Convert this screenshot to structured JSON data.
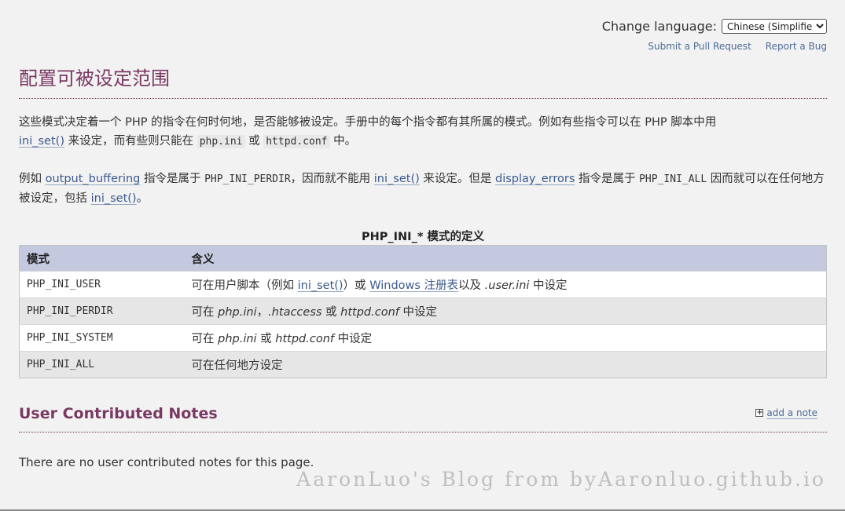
{
  "header": {
    "change_language_label": "Change language:",
    "language_selected": "Chinese (Simplified)",
    "submit_pr": "Submit a Pull Request",
    "report_bug": "Report a Bug"
  },
  "title": "配置可被设定范围",
  "p1": {
    "t1": "这些模式决定着一个 PHP 的指令在何时何地，是否能够被设定。手册中的每个指令都有其所属的模式。例如有些指令可以在 PHP 脚本中用",
    "link_ini_set": "ini_set()",
    "t2": " 来设定，而有些则只能在 ",
    "code_phpini": "php.ini",
    "t3": " 或 ",
    "code_httpd": "httpd.conf",
    "t4": " 中。"
  },
  "p2": {
    "t1": "例如 ",
    "link_output_buffering": "output_buffering",
    "t2": " 指令是属于 ",
    "const_perdir": "PHP_INI_PERDIR",
    "t3": "，因而就不能用 ",
    "link_ini_set": "ini_set()",
    "t4": " 来设定。但是 ",
    "link_display_errors": "display_errors",
    "t5": " 指令是属于 ",
    "const_all": "PHP_INI_ALL",
    "t6": " 因而就可以在任何地方被设定，包括 ",
    "link_ini_set2": "ini_set()",
    "t7": "。"
  },
  "table": {
    "caption": "PHP_INI_* 模式的定义",
    "headers": [
      "模式",
      "含义"
    ],
    "rows": [
      {
        "mode": "PHP_INI_USER",
        "m1": "可在用户脚本（例如 ",
        "link_ini_set": "ini_set()",
        "m2": "）或 ",
        "link_registry": "Windows 注册表",
        "m3": "以及 ",
        "em_userini": ".user.ini",
        "m4": " 中设定"
      },
      {
        "mode": "PHP_INI_PERDIR",
        "m1": "可在 ",
        "em_phpini": "php.ini",
        "m2": "，",
        "em_htaccess": ".htaccess",
        "m3": " 或 ",
        "em_httpd": "httpd.conf",
        "m4": " 中设定"
      },
      {
        "mode": "PHP_INI_SYSTEM",
        "m1": "可在 ",
        "em_phpini": "php.ini",
        "m2": " 或 ",
        "em_httpd": "httpd.conf",
        "m3": " 中设定"
      },
      {
        "mode": "PHP_INI_ALL",
        "m1": "可在任何地方设定"
      }
    ]
  },
  "notes": {
    "title": "User Contributed Notes",
    "add_note": "add a note",
    "empty": "There are no user contributed notes for this page."
  },
  "watermark": "AaronLuo's Blog from byAaronluo.github.io",
  "icons": {
    "add_note": "plus-box-icon",
    "select": "chevron-down-icon"
  },
  "colors": {
    "title": "#793862",
    "link": "#3b5a8f",
    "table_header": "#c4c9df",
    "background": "#f2f2f2"
  }
}
